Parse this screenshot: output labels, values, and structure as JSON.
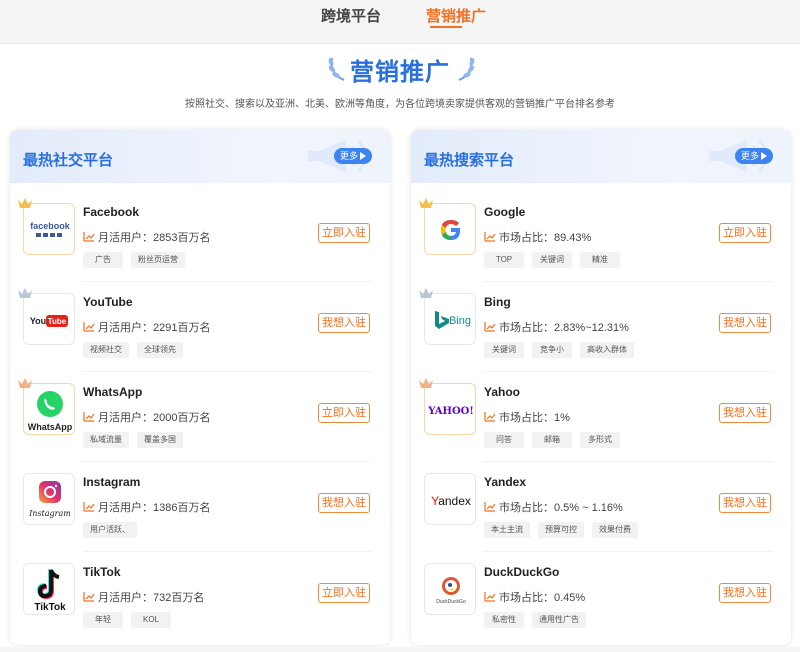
{
  "nav": {
    "tabs": [
      {
        "label": "跨境平台"
      },
      {
        "label": "营销推广"
      }
    ],
    "active_color": "#ee7327"
  },
  "hero": {
    "title": "营销推广",
    "subtitle": "按照社交、搜索以及亚洲、北美、欧洲等角度，为各位跨境卖家提供客观的营销推广平台排名参考"
  },
  "social": {
    "title": "最热社交平台",
    "more_label": "更多",
    "items": [
      {
        "name": "Facebook",
        "stat": "月活用户：2853百万名",
        "tags": [
          "广告",
          "粉丝页运营"
        ],
        "action": "立即入驻",
        "logo": "facebook-logo",
        "rank": "gold"
      },
      {
        "name": "YouTube",
        "stat": "月活用户：2291百万名",
        "tags": [
          "视频社交",
          "全球领先"
        ],
        "action": "我想入驻",
        "logo": "youtube-logo",
        "rank": "silver"
      },
      {
        "name": "WhatsApp",
        "stat": "月活用户：2000百万名",
        "tags": [
          "私域流量",
          "覆盖多国"
        ],
        "action": "立即入驻",
        "logo": "whatsapp-logo",
        "rank": "bronze"
      },
      {
        "name": "Instagram",
        "stat": "月活用户：1386百万名",
        "tags": [
          "用户活跃、"
        ],
        "action": "我想入驻",
        "logo": "instagram-logo",
        "rank": ""
      },
      {
        "name": "TikTok",
        "stat": "月活用户：732百万名",
        "tags": [
          "年轻",
          "KOL"
        ],
        "action": "立即入驻",
        "logo": "tiktok-logo",
        "rank": ""
      }
    ]
  },
  "search": {
    "title": "最热搜索平台",
    "more_label": "更多",
    "items": [
      {
        "name": "Google",
        "stat": "市场占比：89.43%",
        "tags": [
          "TOP",
          "关键词",
          "精准"
        ],
        "action": "立即入驻",
        "logo": "google-logo",
        "rank": "gold"
      },
      {
        "name": "Bing",
        "stat": "市场占比：2.83%~12.31%",
        "tags": [
          "关键词",
          "竞争小",
          "高收入群体"
        ],
        "action": "我想入驻",
        "logo": "bing-logo",
        "rank": "silver"
      },
      {
        "name": "Yahoo",
        "stat": "市场占比：1%",
        "tags": [
          "问答",
          "邮箱",
          "多形式"
        ],
        "action": "我想入驻",
        "logo": "yahoo-logo",
        "rank": "bronze"
      },
      {
        "name": "Yandex",
        "stat": "市场占比：0.5% ~ 1.16%",
        "tags": [
          "本土主流",
          "预算可控",
          "效果付费"
        ],
        "action": "我想入驻",
        "logo": "yandex-logo",
        "rank": ""
      },
      {
        "name": "DuckDuckGo",
        "stat": "市场占比：0.45%",
        "tags": [
          "私密性",
          "通用性广告"
        ],
        "action": "我想入驻",
        "logo": "duckduckgo-logo",
        "rank": ""
      }
    ]
  },
  "logo_text": {
    "facebook": "facebook",
    "youtube": "YouTube",
    "whatsapp": "WhatsApp",
    "instagram": "Instagram",
    "tiktok": "TikTok",
    "bing": "Bing",
    "yahoo": "YAHOO!",
    "yandex": "Yandex",
    "duckduckgo": "DuckDuckGo"
  },
  "colors": {
    "brand_blue": "#2a6fe0",
    "action_orange": "#f07020"
  }
}
